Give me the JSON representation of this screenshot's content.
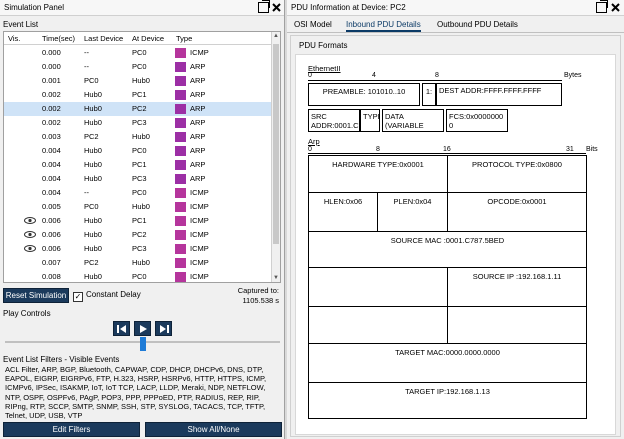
{
  "left_panel": {
    "title": "Simulation Panel",
    "event_list_label": "Event List",
    "columns": [
      "Vis.",
      "Time(sec)",
      "Last Device",
      "At Device",
      "Type"
    ],
    "events": [
      {
        "time": "0.000",
        "last": "--",
        "at": "PC0",
        "type": "ICMP",
        "color": "#b5359c",
        "eye": false
      },
      {
        "time": "0.000",
        "last": "--",
        "at": "PC0",
        "type": "ARP",
        "color": "#9c2fa5",
        "eye": false
      },
      {
        "time": "0.001",
        "last": "PC0",
        "at": "Hub0",
        "type": "ARP",
        "color": "#9c2fa5",
        "eye": false
      },
      {
        "time": "0.002",
        "last": "Hub0",
        "at": "PC1",
        "type": "ARP",
        "color": "#9c2fa5",
        "eye": false
      },
      {
        "time": "0.002",
        "last": "Hub0",
        "at": "PC2",
        "type": "ARP",
        "color": "#9c2fa5",
        "eye": false,
        "selected": true
      },
      {
        "time": "0.002",
        "last": "Hub0",
        "at": "PC3",
        "type": "ARP",
        "color": "#9c2fa5",
        "eye": false
      },
      {
        "time": "0.003",
        "last": "PC2",
        "at": "Hub0",
        "type": "ARP",
        "color": "#9c2fa5",
        "eye": false
      },
      {
        "time": "0.004",
        "last": "Hub0",
        "at": "PC0",
        "type": "ARP",
        "color": "#9c2fa5",
        "eye": false
      },
      {
        "time": "0.004",
        "last": "Hub0",
        "at": "PC1",
        "type": "ARP",
        "color": "#9c2fa5",
        "eye": false
      },
      {
        "time": "0.004",
        "last": "Hub0",
        "at": "PC3",
        "type": "ARP",
        "color": "#9c2fa5",
        "eye": false
      },
      {
        "time": "0.004",
        "last": "--",
        "at": "PC0",
        "type": "ICMP",
        "color": "#b5359c",
        "eye": false
      },
      {
        "time": "0.005",
        "last": "PC0",
        "at": "Hub0",
        "type": "ICMP",
        "color": "#b5359c",
        "eye": false
      },
      {
        "time": "0.006",
        "last": "Hub0",
        "at": "PC1",
        "type": "ICMP",
        "color": "#b5359c",
        "eye": true
      },
      {
        "time": "0.006",
        "last": "Hub0",
        "at": "PC2",
        "type": "ICMP",
        "color": "#b5359c",
        "eye": true
      },
      {
        "time": "0.006",
        "last": "Hub0",
        "at": "PC3",
        "type": "ICMP",
        "color": "#b5359c",
        "eye": true
      },
      {
        "time": "0.007",
        "last": "PC2",
        "at": "Hub0",
        "type": "ICMP",
        "color": "#b5359c",
        "eye": false
      },
      {
        "time": "0.008",
        "last": "Hub0",
        "at": "PC0",
        "type": "ICMP",
        "color": "#b5359c",
        "eye": false
      }
    ],
    "reset_label": "Reset Simulation",
    "constant_delay_label": "Constant Delay",
    "constant_delay_checked": true,
    "captured_label": "Captured to:",
    "captured_value": "1105.538 s",
    "play_controls_label": "Play Controls",
    "filters_title": "Event List Filters - Visible Events",
    "filters_text": "ACL Filter, ARP, BGP, Bluetooth, CAPWAP, CDP, DHCP, DHCPv6, DNS, DTP, EAPOL, EIGRP, EIGRPv6, FTP, H.323, HSRP, HSRPv6, HTTP, HTTPS, ICMP, ICMPv6, IPSec, ISAKMP, IoT, IoT TCP, LACP, LLDP, Meraki, NDP, NETFLOW, NTP, OSPF, OSPFv6, PAgP, POP3, PPP, PPPoED, PTP, RADIUS, REP, RIP, RIPng, RTP, SCCP, SMTP, SNMP, SSH, STP, SYSLOG, TACACS, TCP, TFTP, Telnet, UDP, USB, VTP",
    "edit_filters_label": "Edit Filters",
    "show_all_label": "Show All/None"
  },
  "right_panel": {
    "title": "PDU Information at Device: PC2",
    "tabs": [
      "OSI Model",
      "Inbound PDU Details",
      "Outbound PDU Details"
    ],
    "active_tab": 1,
    "pdu_formats_label": "PDU Formats",
    "ethernet": {
      "label": "EthernetII",
      "ticks": [
        "0",
        "4",
        "8"
      ],
      "unit": "Bytes",
      "preamble": "PREAMBLE: 101010..10",
      "sfd": "1:",
      "dest": "DEST ADDR:FFFF.FFFF.FFFF",
      "src": "SRC ADDR:0001.C787.5B",
      "type": "TYPE:",
      "data": "DATA (VARIABLE LENGT",
      "fcs": "FCS:0x0000000 0"
    },
    "arp": {
      "label": "Arp",
      "ticks": [
        "0",
        "8",
        "16",
        "31"
      ],
      "unit": "Bits",
      "hw_type": "HARDWARE TYPE:0x0001",
      "proto_type": "PROTOCOL TYPE:0x0800",
      "hlen": "HLEN:0x06",
      "plen": "PLEN:0x04",
      "opcode": "OPCODE:0x0001",
      "src_mac": "SOURCE MAC :0001.C787.5BED",
      "src_ip": "SOURCE IP :192.168.1.11",
      "tgt_mac": "TARGET MAC:0000.0000.0000",
      "tgt_ip": "TARGET IP:192.168.1.13"
    }
  }
}
